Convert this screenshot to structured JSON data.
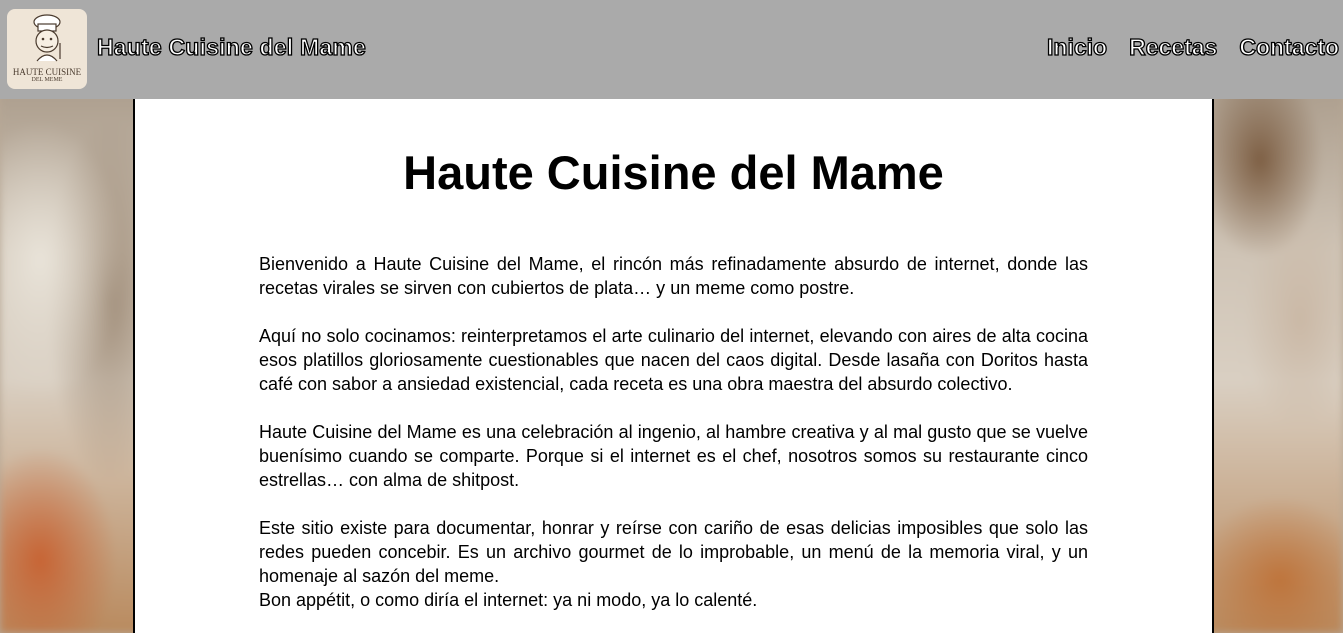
{
  "header": {
    "logo": {
      "line1": "HAUTE CUISINE",
      "line2": "DEL MEME",
      "icon": "chef-meme-icon"
    },
    "site_title": "Haute Cuisine del Mame",
    "nav": [
      {
        "label": "Inicio"
      },
      {
        "label": "Recetas"
      },
      {
        "label": "Contacto"
      }
    ]
  },
  "main": {
    "title": "Haute Cuisine del Mame",
    "paragraphs": [
      "Bienvenido a Haute Cuisine del Mame, el rincón más refinadamente absurdo de internet, donde las recetas virales se sirven con cubiertos de plata… y un meme como postre.",
      "Aquí no solo cocinamos: reinterpretamos el arte culinario del internet, elevando con aires de alta cocina esos platillos gloriosamente cuestionables que nacen del caos digital. Desde lasaña con Doritos hasta café con sabor a ansiedad existencial, cada receta es una obra maestra del absurdo colectivo.",
      "Haute Cuisine del Mame es una celebración al ingenio, al hambre creativa y al mal gusto que se vuelve buenísimo cuando se comparte. Porque si el internet es el chef, nosotros somos su restaurante cinco estrellas… con alma de shitpost.",
      "Este sitio existe para documentar, honrar y reírse con cariño de esas delicias imposibles que solo las redes pueden concebir. Es un archivo gourmet de lo improbable, un menú de la memoria viral, y un homenaje al sazón del meme.",
      "Bon appétit, o como diría el internet: ya ni modo, ya lo calenté."
    ]
  }
}
